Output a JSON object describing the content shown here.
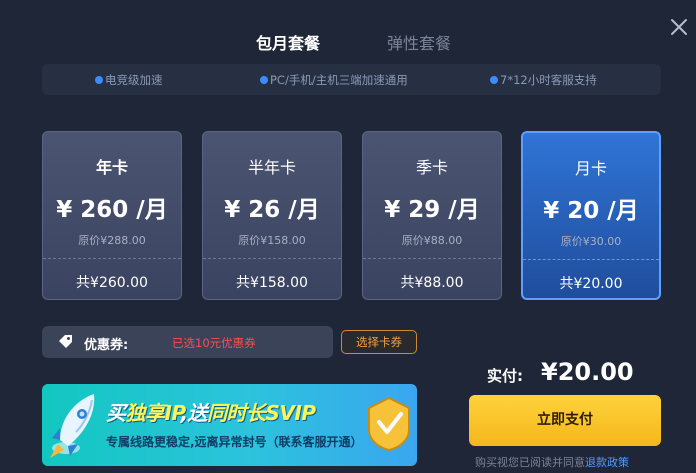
{
  "tabs": [
    {
      "label": "包月套餐",
      "active": true
    },
    {
      "label": "弹性套餐",
      "active": false
    }
  ],
  "features": [
    "电竞级加速",
    "PC/手机/主机三端加速通用",
    "7*12小时客服支持"
  ],
  "plans": [
    {
      "name": "年卡",
      "price": "¥ 260 /月",
      "original": "原价¥288.00",
      "total": "共¥260.00",
      "selected": false
    },
    {
      "name": "半年卡",
      "price": "¥ 26 /月",
      "original": "原价¥158.00",
      "total": "共¥158.00",
      "selected": false
    },
    {
      "name": "季卡",
      "price": "¥ 29 /月",
      "original": "原价¥88.00",
      "total": "共¥88.00",
      "selected": false
    },
    {
      "name": "月卡",
      "price": "¥ 20 /月",
      "original": "原价¥30.00",
      "total": "共¥20.00",
      "selected": true
    }
  ],
  "coupon": {
    "label": "优惠券:",
    "value": "已选10元优惠券",
    "choose_button": "选择卡券"
  },
  "banner": {
    "headline_part1": "买",
    "headline_hl1": "独享IP",
    "headline_part2": ",送",
    "headline_hl2": "同时长SVIP",
    "subtitle": "专属线路更稳定,远离异常封号（联系客服开通）"
  },
  "payment": {
    "paid_label": "实付:",
    "paid_value": "¥20.00",
    "pay_button": "立即支付",
    "agree_text": "购买视您已阅读并同意",
    "policy_link": "退款政策"
  },
  "colors": {
    "background": "#1f2638",
    "accent_blue": "#3b8cff",
    "pay_yellow": "#f4b71a",
    "coupon_red": "#ff4d4d"
  }
}
